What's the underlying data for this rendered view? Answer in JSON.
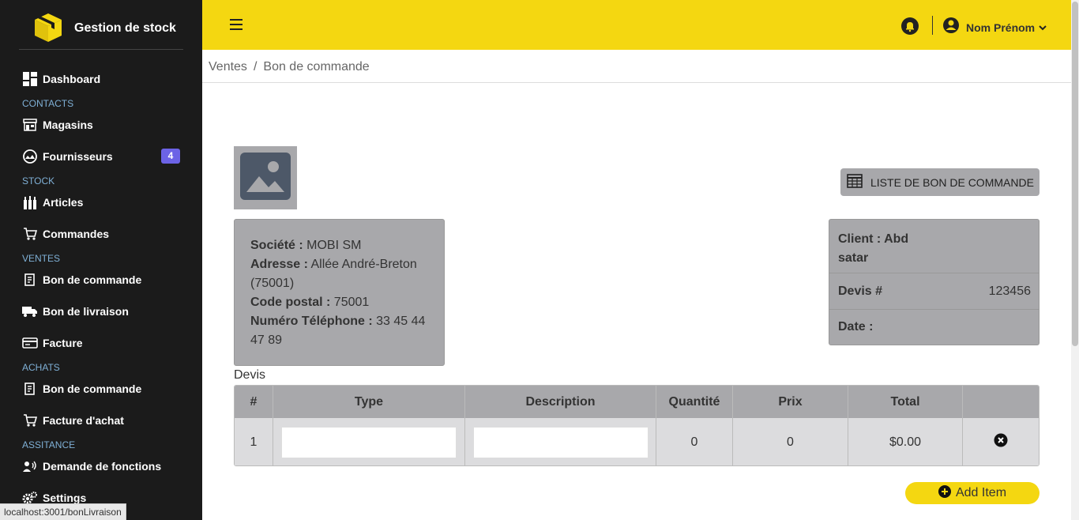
{
  "app": {
    "title": "Gestion de stock"
  },
  "sidebar": {
    "dashboard": "Dashboard",
    "section_contacts": "CONTACTS",
    "magasins": "Magasins",
    "fournisseurs": "Fournisseurs",
    "fournisseurs_badge": "4",
    "section_stock": "STOCK",
    "articles": "Articles",
    "commandes": "Commandes",
    "section_ventes": "VENTES",
    "bon_commande_ventes": "Bon de commande",
    "bon_livraison": "Bon de livraison",
    "facture": "Facture",
    "section_achats": "ACHATS",
    "bon_commande_achats": "Bon de commande",
    "facture_achat": "Facture d'achat",
    "section_assistance": "ASSITANCE",
    "demande_fonctions": "Demande de fonctions",
    "settings": "Settings"
  },
  "status_url": "localhost:3001/bonLivraison",
  "header": {
    "user_name": "Nom Prénom"
  },
  "breadcrumb": {
    "parent": "Ventes",
    "sep": "/",
    "current": "Bon de commande"
  },
  "actions": {
    "list_button": "LISTE DE BON DE COMMANDE",
    "add_item": "Add Item"
  },
  "company": {
    "societe_label": "Société :",
    "societe": "MOBI SM",
    "adresse_label": "Adresse :",
    "adresse": "Allée André-Breton (75001)",
    "code_postal_label": "Code postal :",
    "code_postal": "75001",
    "telephone_label": "Numéro Téléphone :",
    "telephone": "33 45 44 47 89"
  },
  "client": {
    "client_label": "Client : Abd satar",
    "devis_label": "Devis #",
    "devis_number": "123456",
    "date_label": "Date :"
  },
  "devis_title": "Devis",
  "table": {
    "headers": [
      "#",
      "Type",
      "Description",
      "Quantité",
      "Prix",
      "Total",
      ""
    ],
    "rows": [
      {
        "num": "1",
        "type": "",
        "description": "",
        "quantite": "0",
        "prix": "0",
        "total": "$0.00"
      }
    ]
  }
}
